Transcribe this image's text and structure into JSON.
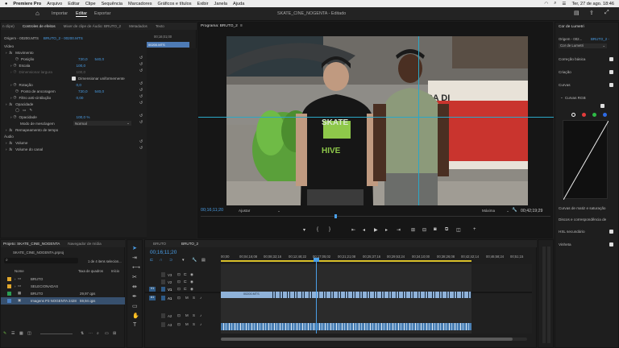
{
  "menubar": {
    "app": "Premiere Pro",
    "items": [
      "Arquivo",
      "Editar",
      "Clipe",
      "Sequência",
      "Marcadores",
      "Gráficos e títulos",
      "Exibir",
      "Janela",
      "Ajuda"
    ],
    "datetime": "Ter, 27 de ago. 18:46"
  },
  "header": {
    "tabs": [
      "Importar",
      "Editar",
      "Exportar"
    ],
    "active_tab": "Editar",
    "project_title": "SKATE_CINE_NOGENTA",
    "status": "Editado"
  },
  "effect_panel": {
    "tabs": [
      "n clipe)",
      "Controles de efeitos",
      "Mixer de clipe de Áudio: BRUTO_2",
      "Metadados",
      "Texto"
    ],
    "source_label": "Origem - 00200.MTS",
    "clip_label": "BRUTO_2 - 00200.MTS",
    "timecode_mini": "00;16;01;00",
    "clip_bar_label": "00200.MTS",
    "section_video": "Vídeo",
    "motion": "Movimento",
    "props": [
      {
        "label": "Posição",
        "v1": "720,0",
        "v2": "540,0"
      },
      {
        "label": "Escala",
        "v1": "100,0",
        "v2": ""
      },
      {
        "label": "Dimensionar largura",
        "v1": "100,0",
        "v2": ""
      },
      {
        "label": "Dimensionar uniformemente",
        "v1": "",
        "v2": ""
      },
      {
        "label": "Rotação",
        "v1": "0,0",
        "v2": ""
      },
      {
        "label": "Ponto de ancoragem",
        "v1": "720,0",
        "v2": "540,0"
      },
      {
        "label": "Filtro anti-cintilação",
        "v1": "0,00",
        "v2": ""
      }
    ],
    "opacity": "Opacidade",
    "opacity_label": "Opacidade",
    "opacity_value": "100,0 %",
    "blend_label": "Modo de mesclagem",
    "blend_value": "Normal",
    "time_remap": "Remapeamento de tempo",
    "section_audio": "Áudio",
    "volume": "Volume",
    "channel_volume": "Volume do canal",
    "bottom_timecode": "00;16;11;20"
  },
  "program": {
    "title": "Programa: BRUTO_2",
    "timecode": "00;16;11;20",
    "fit": "Ajustar",
    "quality": "Máxima",
    "duration": "00;42;19;29",
    "shirt_text_top": "SKATE",
    "shirt_text_bottom": "HIVE",
    "sign_text": "TICA DI"
  },
  "lumetri": {
    "title": "Cor de Lumetri",
    "source": "Origem - 002...",
    "clip": "BRUTO_2 -",
    "effect": "Cor de Lumetri",
    "sections": [
      "Correção básica",
      "Criação",
      "Curvas"
    ],
    "curves_rgb": "Curvas RGB",
    "lower_sections": [
      "Curvas de matiz e saturação",
      "Discos e correspondência de",
      "HSL secundário",
      "Vinheta"
    ],
    "channel_colors": [
      "#ffffff",
      "#e33b3b",
      "#2dbb46",
      "#2e6be6"
    ]
  },
  "project": {
    "tabs": [
      "Projeto: SKATE_CINE_NOGENTA",
      "Navegador de mídia"
    ],
    "file": "SKATE_CINE_NOGENTA.prproj",
    "selection": "1 de 4 itens selecion...",
    "col_name": "Nome",
    "col_rate": "Taxa de quadros",
    "col_start": "Início",
    "items": [
      {
        "name": "BRUTO",
        "rate": "",
        "color": "#e0a72c"
      },
      {
        "name": "SELECIONADAS",
        "rate": "",
        "color": "#e0a72c"
      },
      {
        "name": "BRUTO",
        "rate": "29,97 qps",
        "color": "#2c9e54"
      },
      {
        "name": "Imagens P3 NOGENTA 2428",
        "rate": "59,94 qps",
        "color": "#4a7fc1"
      }
    ]
  },
  "timeline": {
    "tabs": [
      "BRUTO",
      "BRUTO_2"
    ],
    "timecode": "00;16;11;20",
    "ruler": [
      "00;00",
      "00;04;16;08",
      "00;08;32;16",
      "00;12;48;22",
      "00;17;05;02",
      "00;21;21;08",
      "00;25;37;16",
      "00;29;53;24",
      "00;34;10;00",
      "00;38;26;08",
      "00;42;42;14",
      "00;46;58;24",
      "00;51;15"
    ],
    "tracks": [
      "V3",
      "V2",
      "V1",
      "A1",
      "A2",
      "A3"
    ],
    "clip_label": "00200.MTS"
  }
}
